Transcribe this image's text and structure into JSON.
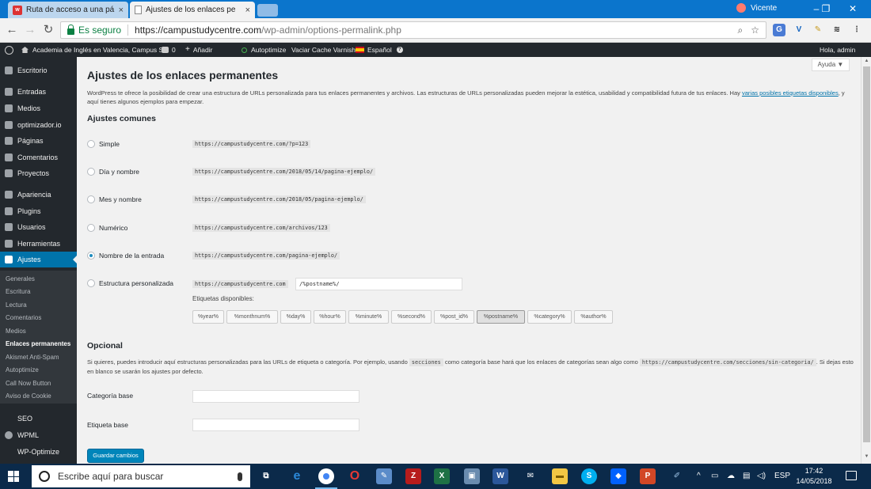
{
  "browser": {
    "tabs": [
      {
        "label": "Ruta de acceso a una pá"
      },
      {
        "label": "Ajustes de los enlaces pe"
      }
    ],
    "user": "Vicente",
    "secure_label": "Es seguro",
    "url_host": "https://campustudycentre.com",
    "url_path": "/wp-admin/options-permalink.php"
  },
  "adminbar": {
    "site_name": "Academia de Inglés en Valencia, Campus S...",
    "comments_count": "0",
    "new_label": "Añadir",
    "autoptimize": "Autoptimize",
    "varnish": "Vaciar Cache Varnish",
    "language": "Español",
    "greeting": "Hola, admin"
  },
  "sidebar": {
    "items": [
      {
        "label": "Escritorio"
      },
      {
        "label": "Entradas"
      },
      {
        "label": "Medios"
      },
      {
        "label": "optimizador.io"
      },
      {
        "label": "Páginas"
      },
      {
        "label": "Comentarios"
      },
      {
        "label": "Proyectos"
      },
      {
        "label": "Apariencia"
      },
      {
        "label": "Plugins"
      },
      {
        "label": "Usuarios"
      },
      {
        "label": "Herramientas"
      },
      {
        "label": "Ajustes"
      }
    ],
    "submenu": [
      {
        "label": "Generales"
      },
      {
        "label": "Escritura"
      },
      {
        "label": "Lectura"
      },
      {
        "label": "Comentarios"
      },
      {
        "label": "Medios"
      },
      {
        "label": "Enlaces permanentes"
      },
      {
        "label": "Akismet Anti-Spam"
      },
      {
        "label": "Autoptimize"
      },
      {
        "label": "Call Now Button"
      },
      {
        "label": "Aviso de Cookie"
      }
    ],
    "extra": [
      {
        "label": "SEO"
      },
      {
        "label": "WPML"
      },
      {
        "label": "WP-Optimize"
      }
    ]
  },
  "main": {
    "help_label": "Ayuda ▼",
    "title": "Ajustes de los enlaces permanentes",
    "intro_text": "WordPress te ofrece la posibilidad de crear una estructura de URLs personalizada para tus enlaces permanentes y archivos. Las estructuras de URLs personalizadas pueden mejorar la estética, usabilidad y compatibilidad futura de tus enlaces. Hay ",
    "intro_link": "varias posibles etiquetas disponibles",
    "intro_tail": ", y aquí tienes algunos ejemplos para empezar.",
    "common_heading": "Ajustes comunes",
    "options": [
      {
        "label": "Simple",
        "example": "https://campustudycentre.com/?p=123"
      },
      {
        "label": "Día y nombre",
        "example": "https://campustudycentre.com/2018/05/14/pagina-ejemplo/"
      },
      {
        "label": "Mes y nombre",
        "example": "https://campustudycentre.com/2018/05/pagina-ejemplo/"
      },
      {
        "label": "Numérico",
        "example": "https://campustudycentre.com/archivos/123"
      },
      {
        "label": "Nombre de la entrada",
        "example": "https://campustudycentre.com/pagina-ejemplo/"
      },
      {
        "label": "Estructura personalizada",
        "example": "https://campustudycentre.com"
      }
    ],
    "selected_option": "Nombre de la entrada",
    "custom_value": "/%postname%/",
    "tags_label": "Etiquetas disponibles:",
    "tags": [
      "%year%",
      "%monthnum%",
      "%day%",
      "%hour%",
      "%minute%",
      "%second%",
      "%post_id%",
      "%postname%",
      "%category%",
      "%author%"
    ],
    "optional_heading": "Opcional",
    "optional_text_1": "Si quieres, puedes introducir aquí estructuras personalizadas para las URLs de etiqueta o categoría. Por ejemplo, usando ",
    "optional_code_1": "secciones",
    "optional_text_2": " como categoría base hará que los enlaces de categorías sean algo como ",
    "optional_code_2": "https://campustudycentre.com/secciones/sin-categoria/",
    "optional_text_3": ". Si dejas esto en blanco se usarán los ajustes por defecto.",
    "category_base_label": "Categoría base",
    "tag_base_label": "Etiqueta base",
    "save_label": "Guardar cambios"
  },
  "taskbar": {
    "search_placeholder": "Escribe aquí para buscar",
    "lang": "ESP",
    "time": "17:42",
    "date": "14/05/2018"
  }
}
